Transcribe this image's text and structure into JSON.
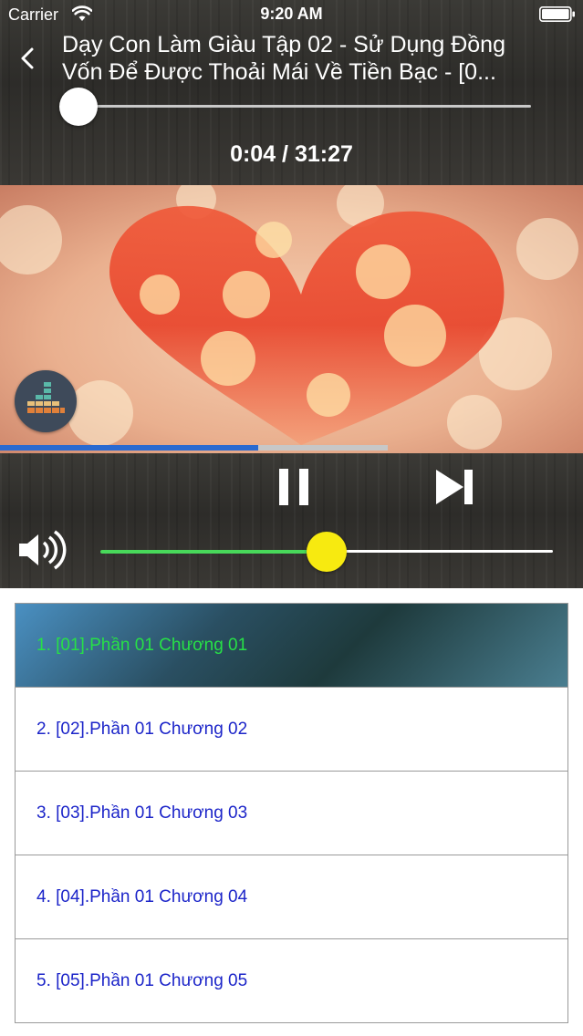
{
  "status_bar": {
    "carrier": "Carrier",
    "time": "9:20 AM"
  },
  "header": {
    "title_line1": "Dạy Con Làm Giàu Tập 02 - Sử Dụng Đồng",
    "title_line2": "Vốn  Để Được Thoải Mái Về Tiền Bạc -  [0..."
  },
  "player": {
    "time_readout": "0:04 / 31:27",
    "seek_progress": 0.002,
    "buffer_progress": 0.665,
    "volume_level": 0.5,
    "playing": true
  },
  "colors": {
    "active_text": "#27e047",
    "item_text": "#1c25c9",
    "volume_fill": "#48d85a",
    "volume_knob": "#f7ea10"
  },
  "icons": [
    "wifi-icon",
    "battery-icon",
    "back-icon",
    "equalizer-icon",
    "pause-icon",
    "skip-next-icon",
    "speaker-icon"
  ],
  "playlist": {
    "items": [
      {
        "label": "1. [01].Phần 01 Chương 01",
        "active": true
      },
      {
        "label": "2. [02].Phần 01 Chương 02",
        "active": false
      },
      {
        "label": "3. [03].Phần 01 Chương 03",
        "active": false
      },
      {
        "label": "4. [04].Phần 01 Chương 04",
        "active": false
      },
      {
        "label": "5. [05].Phần 01 Chương 05",
        "active": false
      }
    ]
  }
}
